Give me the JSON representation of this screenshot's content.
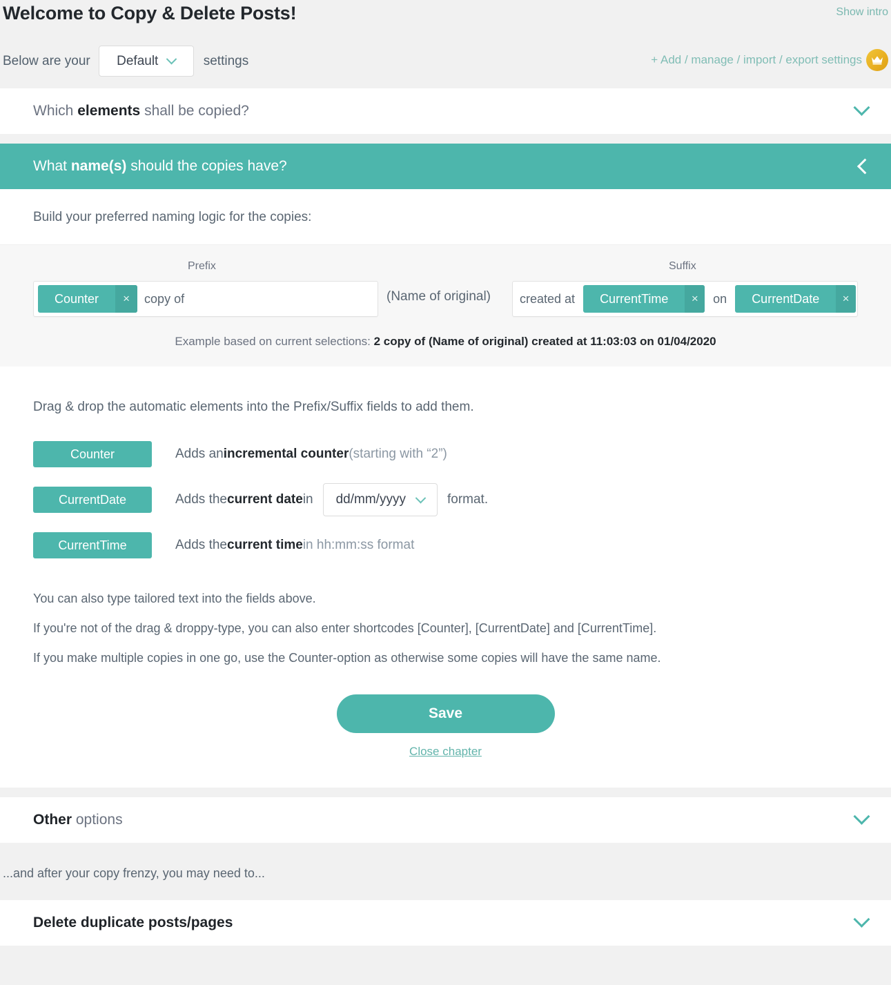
{
  "header": {
    "title": "Welcome to Copy & Delete Posts!",
    "show_intro": "Show intro",
    "settings_prefix": "Below are your",
    "settings_value": "Default",
    "settings_suffix": "settings",
    "manage_link": "+ Add / manage / import / export settings",
    "crown_icon": "crown-icon"
  },
  "accordions": {
    "elements": {
      "lead": "Which ",
      "bold": "elements",
      "tail": " shall be copied?"
    },
    "names": {
      "lead": "What ",
      "bold": "name(s)",
      "tail": " should the copies have?"
    },
    "other": {
      "lead": "",
      "bold": "Other",
      "tail": " options"
    },
    "delete": {
      "lead": "",
      "bold": "Delete duplicate posts/pages",
      "tail": ""
    }
  },
  "names_panel": {
    "build_line": "Build your preferred naming logic for the copies:",
    "prefix_label": "Prefix",
    "suffix_label": "Suffix",
    "name_of_original": "(Name of original)",
    "prefix_field": {
      "tag": "Counter",
      "tag_remove": "×",
      "text": "copy of"
    },
    "suffix_field": {
      "lead_text": "created at",
      "tag1": "CurrentTime",
      "tag1_remove": "×",
      "mid_text": "on",
      "tag2": "CurrentDate",
      "tag2_remove": "×"
    },
    "example_label": "Example based on current selections:",
    "example_value": "2 copy of (Name of original) created at 11:03:03 on 01/04/2020",
    "dd_intro": "Drag & drop the automatic elements into the Prefix/Suffix fields to add them.",
    "dd_rows": [
      {
        "chip": "Counter",
        "desc_pre": "Adds an ",
        "desc_bold": "incremental counter",
        "desc_post": " (starting with “2”)"
      },
      {
        "chip": "CurrentDate",
        "desc_pre": "Adds the ",
        "desc_bold": "current date",
        "desc_post": " in",
        "select_value": "dd/mm/yyyy",
        "desc_tail": "format."
      },
      {
        "chip": "CurrentTime",
        "desc_pre": "Adds the ",
        "desc_bold": "current time",
        "desc_post": " in hh:mm:ss format"
      }
    ],
    "notes": [
      "You can also type tailored text into the fields above.",
      "If you're not of the drag & droppy-type, you can also enter shortcodes [Counter], [CurrentDate] and [CurrentTime].",
      "If you make multiple copies in one go, use the Counter-option as otherwise some copies will have the same name."
    ],
    "save_label": "Save",
    "close_chapter": "Close chapter"
  },
  "after_note": "...and after your copy frenzy, you may need to...",
  "colors": {
    "accent": "#4db6ac",
    "accent_dark": "#45a89f",
    "crown": "#e8ae1f",
    "page_bg": "#f1f1f1",
    "builder_bg": "#f7f7f7"
  }
}
